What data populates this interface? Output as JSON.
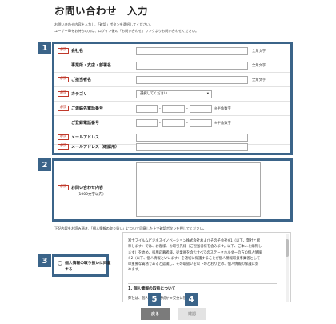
{
  "page": {
    "title": "お問い合わせ　入力"
  },
  "intro": {
    "line1": "お問い合わせ内容を入力し、「確認」ボタンを選択してください。",
    "line2": "ユーザーIDをお持ちの方は、ログイン後の「お問い合わせ」リンクよりお問い合わせください。"
  },
  "badges": {
    "b1": "1",
    "b2": "2",
    "b3": "3",
    "b4": "4",
    "b5": "5"
  },
  "required_label": "必須",
  "form": {
    "company": {
      "label": "会社名",
      "hint": "全角文字"
    },
    "department": {
      "label": "事業所・支店・部署名",
      "hint": "全角文字"
    },
    "name": {
      "label": "ご担当者名",
      "hint": "全角文字"
    },
    "category": {
      "label": "カテゴリ",
      "selected": "選択してください",
      "arrow": "▾"
    },
    "contact_phone": {
      "label": "ご連絡先電話番号",
      "hint": "※半角数字",
      "sep": "-"
    },
    "registered_phone": {
      "label": "ご登録電話番号",
      "hint": "※半角数字",
      "sep": "-"
    },
    "email": {
      "label": "メールアドレス"
    },
    "email_confirm": {
      "label": "メールアドレス（確認用）"
    },
    "inquiry": {
      "label": "お問い合わせ内容",
      "sublabel": "（1000文字以内）"
    }
  },
  "privacy": {
    "instruction": "下記内容をお読み頂き、「個人情報の取り扱い」について同意した上で確認ボタンを押してください。",
    "checkbox_label_1": "個人情報の取り扱いに同意",
    "checkbox_label_2": "する",
    "body_lines": [
      "富士フイルムビジネスイノベーション株式会社およびその子会社※1（以下、弊社と総",
      "称します）では、お客様、お取引先様（ご担当者様を含みます。以下、ご本人と総称し",
      "ます）を始め、採用応募者様、従業員を含むすべてのステークホルダーの方の個人情報",
      "※2（以下、個人情報といいます）を適切に保護することが個人情報取扱事業者として",
      "の重要な責務であると認識し、その取扱いを以下のとおり定め、個人情報の保護に努",
      "めます。"
    ],
    "section_heading": "1. 個人情報の取扱について",
    "section_line": "弊社は、個人情報を適切かつ安全に管理し..."
  },
  "buttons": {
    "back": "戻る",
    "confirm": "確認"
  }
}
